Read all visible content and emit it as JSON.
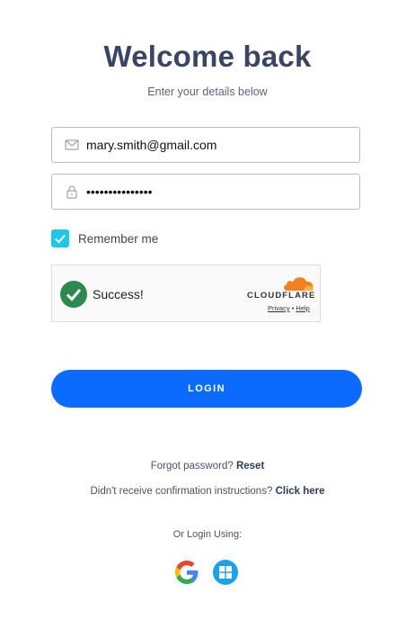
{
  "header": {
    "title": "Welcome back",
    "subtitle": "Enter your details below"
  },
  "form": {
    "email": {
      "value": "mary.smith@gmail.com",
      "icon": "envelope-icon"
    },
    "password": {
      "value": "•••••••••••••••",
      "icon": "lock-icon"
    },
    "remember_me": {
      "label": "Remember me",
      "checked": true
    }
  },
  "captcha": {
    "status": "Success!",
    "brand": "CLOUDFLARE",
    "privacy_label": "Privacy",
    "separator": "•",
    "help_label": "Help"
  },
  "actions": {
    "login_label": "LOGIN",
    "forgot_text": "Forgot password?",
    "reset_label": "Reset",
    "confirm_text": "Didn't receive confirmation instructions?",
    "click_here_label": "Click here",
    "or_login_text": "Or Login Using:"
  },
  "social": [
    {
      "name": "google",
      "icon": "google-icon"
    },
    {
      "name": "windows",
      "icon": "windows-icon"
    }
  ],
  "colors": {
    "title": "#3a4566",
    "primary": "#0b6bff",
    "checkbox": "#1ec7ea",
    "success": "#2d8a4e",
    "cloudflare": "#f48120"
  }
}
